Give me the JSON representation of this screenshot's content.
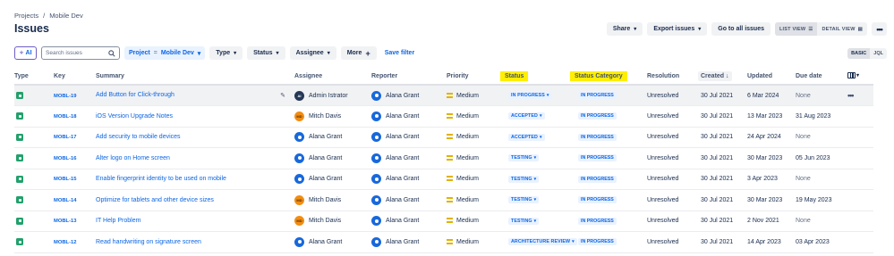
{
  "breadcrumb": {
    "items": [
      "Projects",
      "Mobile Dev"
    ],
    "separator": "/"
  },
  "page_title": "Issues",
  "toolbar": {
    "share_label": "Share",
    "export_label": "Export issues",
    "goto_all_label": "Go to all issues",
    "list_view_label": "LIST VIEW",
    "detail_view_label": "DETAIL VIEW"
  },
  "filters": {
    "ai_label": "AI",
    "search_placeholder": "Search issues",
    "project_label": "Project",
    "project_operator": "=",
    "project_value": "Mobile Dev",
    "type_label": "Type",
    "status_label": "Status",
    "assignee_label": "Assignee",
    "more_label": "More",
    "save_filter_label": "Save filter",
    "basic_label": "BASIC",
    "jql_label": "JQL"
  },
  "columns": {
    "type": "Type",
    "key": "Key",
    "summary": "Summary",
    "assignee": "Assignee",
    "reporter": "Reporter",
    "priority": "Priority",
    "status": "Status",
    "status_category": "Status Category",
    "resolution": "Resolution",
    "created": "Created",
    "updated": "Updated",
    "due_date": "Due date"
  },
  "rows": [
    {
      "key": "MOBL-19",
      "summary": "Add Button for Click-through",
      "assignee": "Admin Istrator",
      "assignee_initials": "AI",
      "reporter": "Alana Grant",
      "priority": "Medium",
      "status": "IN PROGRESS",
      "status_category": "IN PROGRESS",
      "resolution": "Unresolved",
      "created": "30 Jul 2021",
      "updated": "6 Mar 2024",
      "due": "None"
    },
    {
      "key": "MOBL-18",
      "summary": "iOS Version Upgrade Notes",
      "assignee": "Mitch Davis",
      "assignee_initials": "MD",
      "reporter": "Alana Grant",
      "priority": "Medium",
      "status": "ACCEPTED",
      "status_category": "IN PROGRESS",
      "resolution": "Unresolved",
      "created": "30 Jul 2021",
      "updated": "13 Mar 2023",
      "due": "31 Aug 2023"
    },
    {
      "key": "MOBL-17",
      "summary": "Add security to mobile devices",
      "assignee": "Alana Grant",
      "assignee_initials": "",
      "reporter": "Alana Grant",
      "priority": "Medium",
      "status": "ACCEPTED",
      "status_category": "IN PROGRESS",
      "resolution": "Unresolved",
      "created": "30 Jul 2021",
      "updated": "24 Apr 2024",
      "due": "None"
    },
    {
      "key": "MOBL-16",
      "summary": "Alter logo on Home screen",
      "assignee": "Alana Grant",
      "assignee_initials": "",
      "reporter": "Alana Grant",
      "priority": "Medium",
      "status": "TESTING",
      "status_category": "IN PROGRESS",
      "resolution": "Unresolved",
      "created": "30 Jul 2021",
      "updated": "30 Mar 2023",
      "due": "05 Jun 2023"
    },
    {
      "key": "MOBL-15",
      "summary": "Enable fingerprint identity to be used on mobile",
      "assignee": "Alana Grant",
      "assignee_initials": "",
      "reporter": "Alana Grant",
      "priority": "Medium",
      "status": "TESTING",
      "status_category": "IN PROGRESS",
      "resolution": "Unresolved",
      "created": "30 Jul 2021",
      "updated": "3 Apr 2023",
      "due": "None"
    },
    {
      "key": "MOBL-14",
      "summary": "Optimize for tablets and other device sizes",
      "assignee": "Mitch Davis",
      "assignee_initials": "MD",
      "reporter": "Alana Grant",
      "priority": "Medium",
      "status": "TESTING",
      "status_category": "IN PROGRESS",
      "resolution": "Unresolved",
      "created": "30 Jul 2021",
      "updated": "30 Mar 2023",
      "due": "19 May 2023"
    },
    {
      "key": "MOBL-13",
      "summary": "IT Help Problem",
      "assignee": "Mitch Davis",
      "assignee_initials": "MD",
      "reporter": "Alana Grant",
      "priority": "Medium",
      "status": "TESTING",
      "status_category": "IN PROGRESS",
      "resolution": "Unresolved",
      "created": "30 Jul 2021",
      "updated": "2 Nov 2021",
      "due": "None"
    },
    {
      "key": "MOBL-12",
      "summary": "Read handwriting on signature screen",
      "assignee": "Alana Grant",
      "assignee_initials": "",
      "reporter": "Alana Grant",
      "priority": "Medium",
      "status": "ARCHITECTURE REVIEW",
      "status_category": "IN PROGRESS",
      "resolution": "Unresolved",
      "created": "30 Jul 2021",
      "updated": "14 Apr 2023",
      "due": "03 Apr 2023"
    }
  ],
  "colors": {
    "accent": "#0c66e4",
    "highlight": "#ffee00",
    "ai_border": "#6e5dc6",
    "story_green": "#22a06b",
    "priority_medium": "#e2b203"
  }
}
